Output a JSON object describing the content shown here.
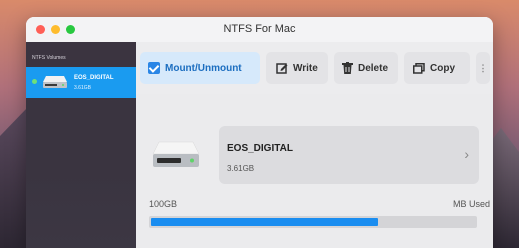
{
  "window": {
    "title": "NTFS For Mac"
  },
  "sidebar": {
    "section_title": "NTFS Volumes",
    "volumes": [
      {
        "name": "EOS_DIGITAL",
        "size": "3.61GB",
        "mounted": true
      }
    ]
  },
  "toolbar": {
    "mount_label": "Mount/Unmount",
    "write_label": "Write",
    "delete_label": "Delete",
    "copy_label": "Copy",
    "more_label": "⋮"
  },
  "detail": {
    "volume_name": "EOS_DIGITAL",
    "volume_size": "3.61GB",
    "capacity_label": "100GB",
    "used_label": "MB Used",
    "usage_fraction": 0.7
  },
  "colors": {
    "accent": "#1a9bf0",
    "progress": "#1a8df0"
  }
}
